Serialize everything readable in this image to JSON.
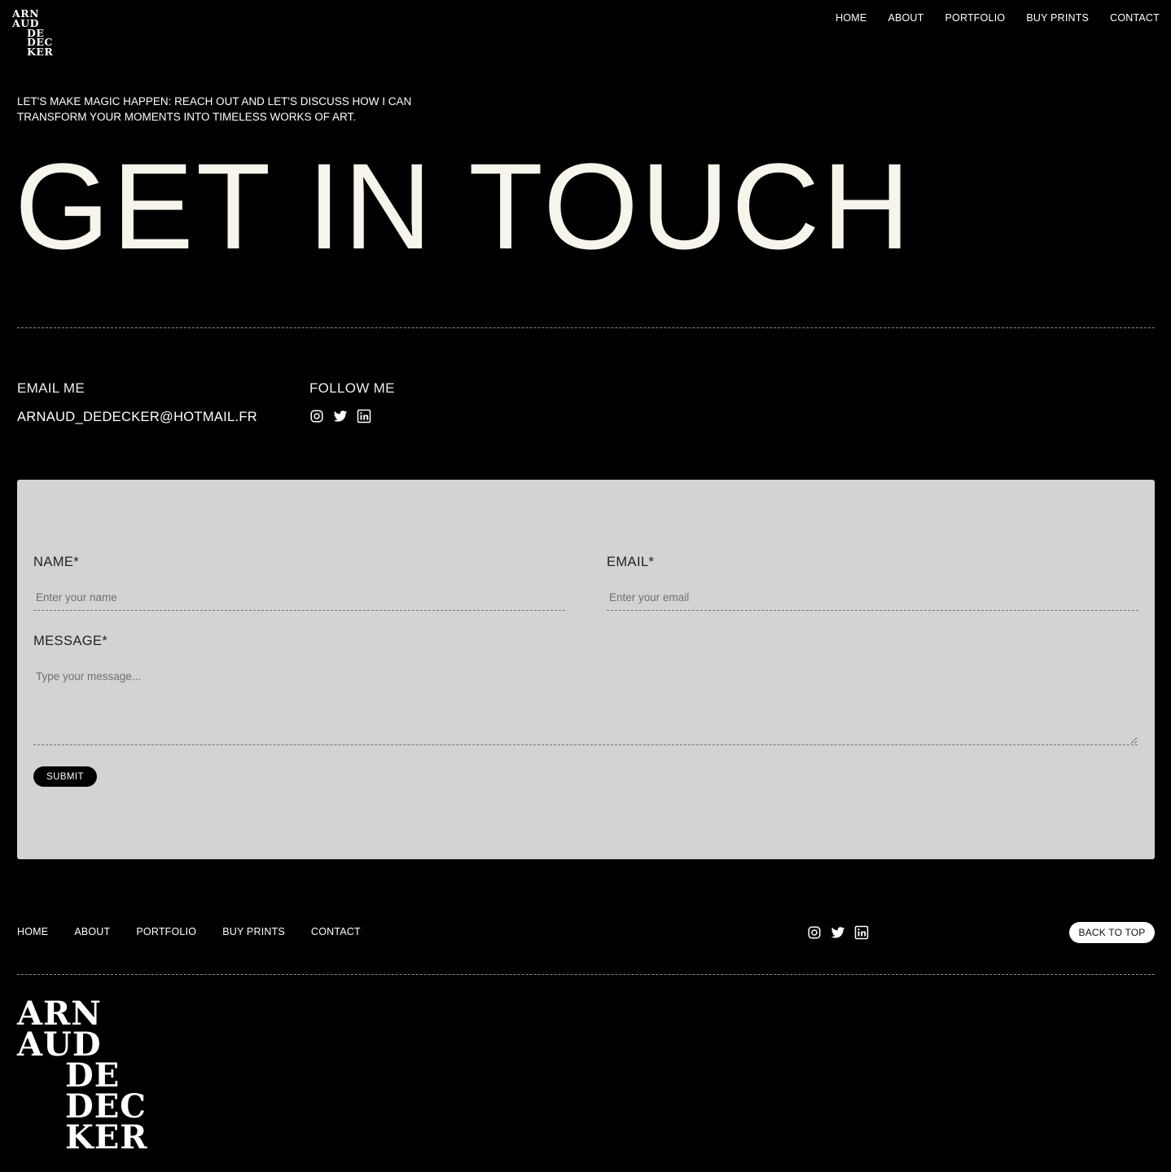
{
  "brand": {
    "logo_lines": [
      "ARN",
      "AUD",
      "DE",
      "DEC",
      "KER"
    ]
  },
  "nav": {
    "items": [
      "HOME",
      "ABOUT",
      "PORTFOLIO",
      "BUY PRINTS",
      "CONTACT"
    ]
  },
  "intro": {
    "text": "LET'S MAKE MAGIC HAPPEN: REACH OUT AND LET'S DISCUSS HOW I CAN TRANSFORM YOUR MOMENTS INTO TIMELESS WORKS OF ART."
  },
  "hero": {
    "title": "GET IN TOUCH"
  },
  "contact": {
    "email_heading": "EMAIL ME",
    "email_value": "ARNAUD_DEDECKER@HOTMAIL.FR",
    "follow_heading": "FOLLOW ME",
    "social_icons": [
      "instagram-icon",
      "twitter-icon",
      "linkedin-icon"
    ]
  },
  "form": {
    "name_label": "NAME*",
    "name_placeholder": "Enter your name",
    "email_label": "EMAIL*",
    "email_placeholder": "Enter your email",
    "message_label": "MESSAGE*",
    "message_placeholder": "Type your message...",
    "submit_label": "SUBMIT"
  },
  "footer": {
    "nav_items": [
      "HOME",
      "ABOUT",
      "PORTFOLIO",
      "BUY PRINTS",
      "CONTACT"
    ],
    "back_to_top": "BACK TO TOP"
  },
  "colors": {
    "background": "#000000",
    "panel": "#d3d3d3",
    "hero_text": "#f7f4ec"
  }
}
